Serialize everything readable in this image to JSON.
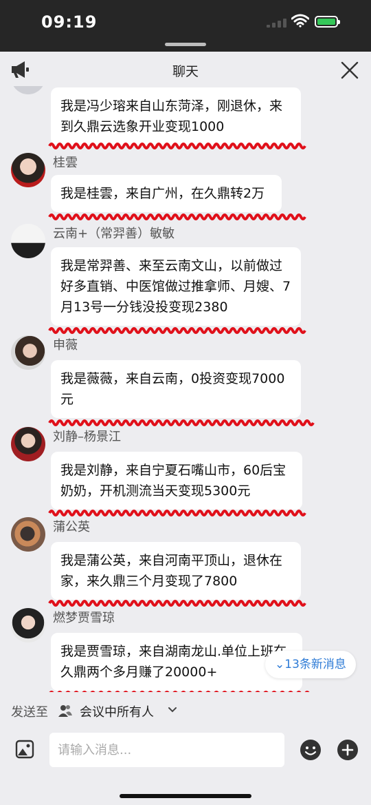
{
  "status": {
    "time": "09:19"
  },
  "header": {
    "title": "聊天"
  },
  "messages": [
    {
      "name": "",
      "text": "我是冯少瑢来自山东菏泽，刚退休，来到久鼎云选象开业变现1000"
    },
    {
      "name": "桂雲",
      "text": "我是桂雲，来自广州，在久鼎转2万"
    },
    {
      "name": "云南+（常羿善）敏敏",
      "text": "我是常羿善、来至云南文山，以前做过好多直销、中医馆做过推拿师、月嫂、7月13号一分钱没投变现2380"
    },
    {
      "name": "申薇",
      "text": "我是薇薇，来自云南，0投资变现7000元"
    },
    {
      "name": "刘静–杨景江",
      "text": "我是刘静，来自宁夏石嘴山市，60后宝奶奶，开机测流当天变现5300元"
    },
    {
      "name": "蒲公英",
      "text": "我是蒲公英，来自河南平顶山，退休在家，来久鼎三个月变现了7800"
    },
    {
      "name": "燃梦贾雪琼",
      "text": "我是贾雪琼，来自湖南龙山.单位上班在久鼎两个多月赚了20000+"
    }
  ],
  "new_messages": "13条新消息",
  "composer": {
    "send_to_label": "发送至",
    "send_to_target": "会议中所有人",
    "placeholder": "请输入消息..."
  },
  "colors": {
    "accent": "#2e7bd6",
    "underline": "#e0101a",
    "battery": "#35c759"
  }
}
